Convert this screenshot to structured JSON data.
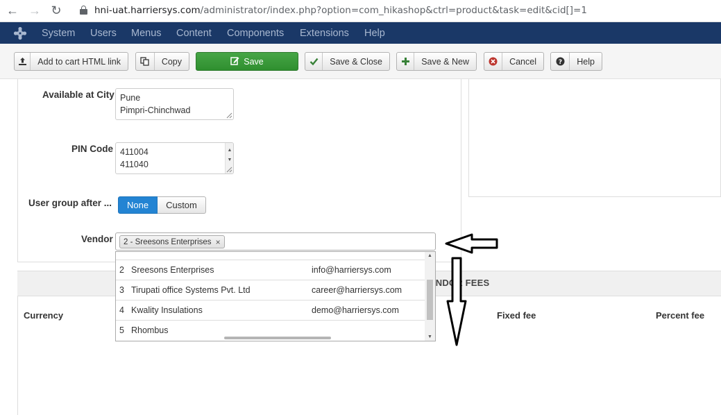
{
  "browser": {
    "url_host": "hni-uat.harriersys.com",
    "url_path": "/administrator/index.php?option=com_hikashop&ctrl=product&task=edit&cid[]=1"
  },
  "topnav": {
    "items": [
      "System",
      "Users",
      "Menus",
      "Content",
      "Components",
      "Extensions",
      "Help"
    ]
  },
  "toolbar": {
    "add_to_cart_label": "Add to cart HTML link",
    "copy_label": "Copy",
    "save_label": "Save",
    "save_close_label": "Save & Close",
    "save_new_label": "Save & New",
    "cancel_label": "Cancel",
    "help_label": "Help"
  },
  "form": {
    "city_label": "Available at City",
    "city_lines": [
      "Pune",
      "Pimpri-Chinchwad"
    ],
    "pin_label": "PIN Code",
    "pin_lines": [
      "411004",
      "411040"
    ],
    "usergroup_label": "User group after ...",
    "usergroup_options": [
      "None",
      "Custom"
    ],
    "usergroup_selected": "None",
    "vendor_label": "Vendor",
    "vendor_selected": "2 - Sreesons Enterprises"
  },
  "vendor_dropdown": {
    "rows": [
      {
        "id": "2",
        "name": "Sreesons Enterprises",
        "email": "info@harriersys.com"
      },
      {
        "id": "3",
        "name": "Tirupati office Systems Pvt. Ltd",
        "email": "career@harriersys.com"
      },
      {
        "id": "4",
        "name": "Kwality Insulations",
        "email": "demo@harriersys.com"
      },
      {
        "id": "5",
        "name": "Rhombus",
        "email": ""
      }
    ]
  },
  "fees": {
    "title": "VENDOR FEES",
    "col_currency": "Currency",
    "col_fixed": "Fixed fee",
    "col_percent": "Percent fee"
  }
}
